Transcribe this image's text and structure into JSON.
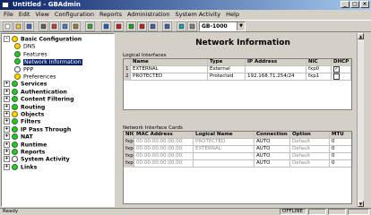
{
  "window": {
    "title": "Untitled - GBAdmin"
  },
  "menu": [
    "File",
    "Edit",
    "View",
    "Configuration",
    "Reports",
    "Administration",
    "System Activity",
    "Help"
  ],
  "toolbar": {
    "combo_value": "GB-1000",
    "icons": [
      "new-icon",
      "open-icon",
      "save-icon",
      "print-icon",
      "cut-icon",
      "copy-icon",
      "paste-icon",
      "help-icon",
      "connect-icon",
      "stop-icon",
      "check-icon",
      "cancel-icon",
      "undo-icon",
      "redo-icon",
      "refresh-icon",
      "settings-icon"
    ]
  },
  "tree": [
    {
      "label": "Basic Configuration",
      "bold": true,
      "exp": "-",
      "dot": "y"
    },
    {
      "label": "DNS",
      "bold": false,
      "dot": "y"
    },
    {
      "label": "Features",
      "bold": false,
      "dot": "g"
    },
    {
      "label": "Network Information",
      "bold": false,
      "dot": "g",
      "selected": true
    },
    {
      "label": "PPP",
      "bold": false,
      "dot": "w"
    },
    {
      "label": "Preferences",
      "bold": false,
      "dot": "y"
    },
    {
      "label": "Services",
      "bold": true,
      "exp": "+",
      "dot": "g"
    },
    {
      "label": "Authentication",
      "bold": true,
      "exp": "+",
      "dot": "g"
    },
    {
      "label": "Content Filtering",
      "bold": true,
      "exp": "+",
      "dot": "g"
    },
    {
      "label": "Routing",
      "bold": true,
      "exp": "+",
      "dot": "g"
    },
    {
      "label": "Objects",
      "bold": true,
      "exp": "+",
      "dot": "y"
    },
    {
      "label": "Filters",
      "bold": true,
      "exp": "+",
      "dot": "g"
    },
    {
      "label": "IP Pass Through",
      "bold": true,
      "exp": "+",
      "dot": "g"
    },
    {
      "label": "NAT",
      "bold": true,
      "exp": "+",
      "dot": "g"
    },
    {
      "label": "Runtime",
      "bold": true,
      "exp": "+",
      "dot": "g"
    },
    {
      "label": "Reports",
      "bold": true,
      "exp": "+",
      "dot": "g"
    },
    {
      "label": "System Activity",
      "bold": true,
      "exp": "+",
      "dot": "w"
    },
    {
      "label": "Links",
      "bold": true,
      "exp": "+",
      "dot": "g"
    }
  ],
  "main": {
    "title": "Network Information",
    "logical": {
      "label": "Logical Interfaces",
      "headers": [
        "Name",
        "Type",
        "IP Address",
        "NIC",
        "DHCP"
      ],
      "rows": [
        {
          "num": "1",
          "name": "EXTERNAL",
          "type": "External",
          "ip": "",
          "nic": "fxp0",
          "dhcp": true
        },
        {
          "num": "2",
          "name": "PROTECTED",
          "type": "Protected",
          "ip": "192.168.71.254/24",
          "nic": "fxp1",
          "dhcp": false
        }
      ]
    },
    "nic": {
      "label": "Network Interface Cards",
      "headers": [
        "NIC",
        "MAC Address",
        "Logical Name",
        "Connection",
        "Option",
        "MTU"
      ],
      "rows": [
        {
          "nic": "fxp0",
          "mac": "00:00:00:00:00:00",
          "lname": "PROTECTED",
          "conn": "AUTO",
          "opt": "Default",
          "mtu": "0"
        },
        {
          "nic": "fxp1",
          "mac": "00:00:00:00:00:00",
          "lname": "EXTERNAL",
          "conn": "AUTO",
          "opt": "Default",
          "mtu": "0"
        },
        {
          "nic": "fxp2",
          "mac": "00:00:00:00:00:00",
          "lname": "",
          "conn": "AUTO",
          "opt": "Default",
          "mtu": "0"
        },
        {
          "nic": "fxp3",
          "mac": "00:00:00:00:00:00",
          "lname": "",
          "conn": "AUTO",
          "opt": "Default",
          "mtu": "0"
        }
      ]
    }
  },
  "status": {
    "left": "Ready",
    "mode": "OFFLINE"
  }
}
